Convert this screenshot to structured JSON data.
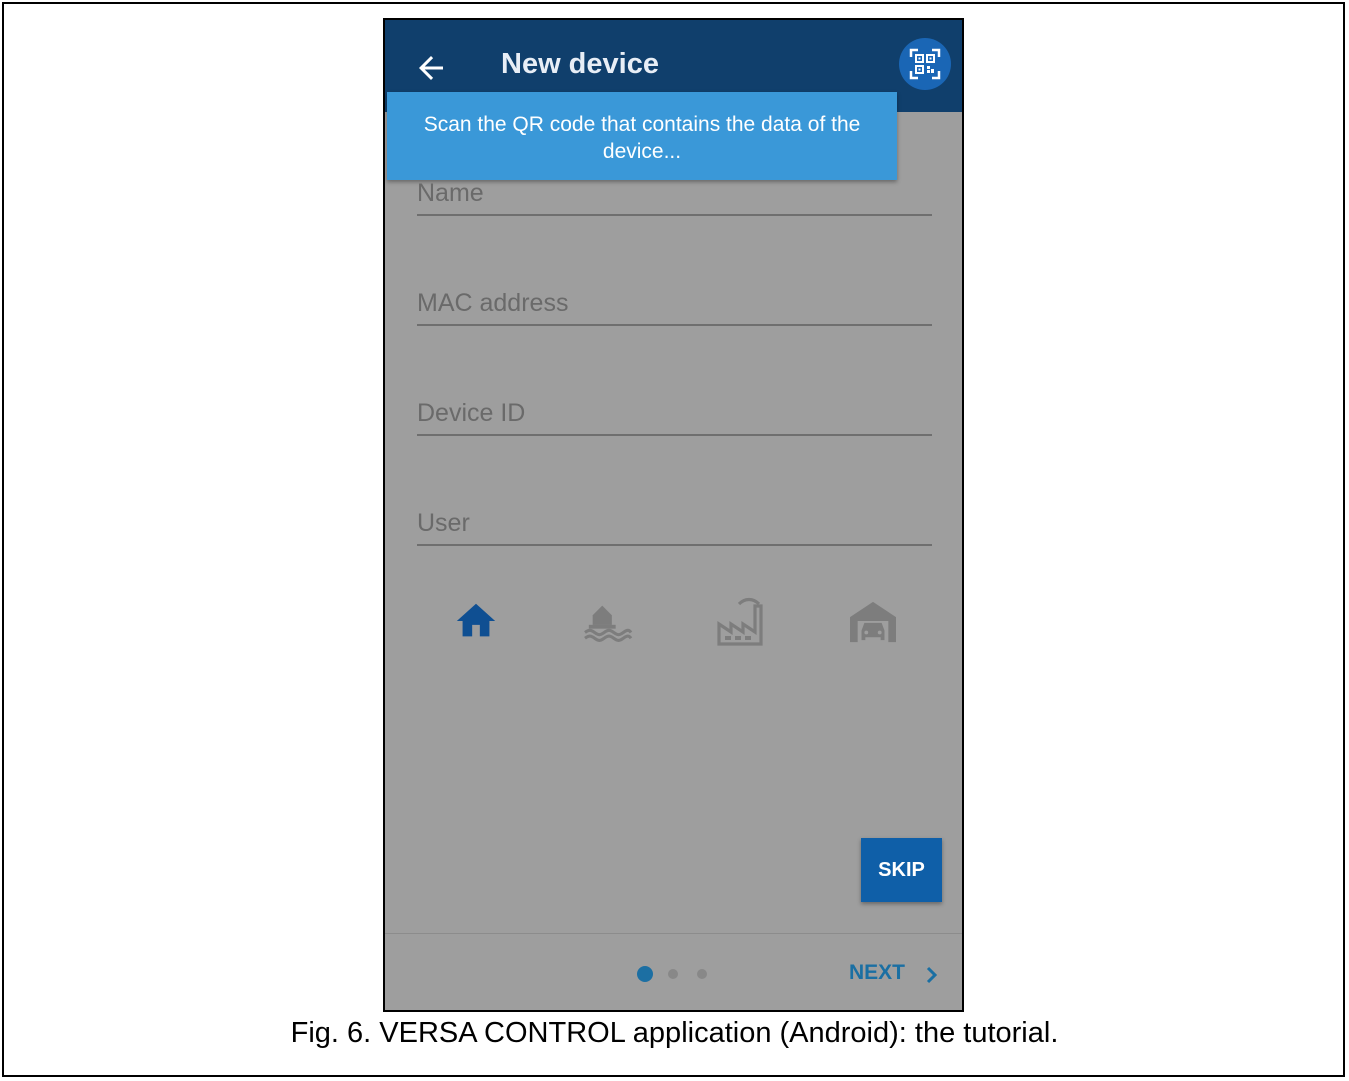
{
  "appbar": {
    "title": "New device",
    "back_icon": "arrow-left-icon",
    "qr_icon": "qr-code-icon",
    "color": "#103f6c"
  },
  "tooltip": {
    "text": "Scan the QR code that contains the data of the device..."
  },
  "fields": {
    "name": "Name",
    "mac": "MAC address",
    "device_id": "Device ID",
    "user": "User"
  },
  "type_icons": {
    "home": "home-icon",
    "seaside": "house-by-water-icon",
    "factory": "factory-icon",
    "garage": "garage-icon",
    "selected": "home"
  },
  "skip_label": "SKIP",
  "pager": {
    "pages": 3,
    "current": 1
  },
  "next_label": "NEXT",
  "caption": "Fig. 6. VERSA CONTROL application (Android): the tutorial."
}
